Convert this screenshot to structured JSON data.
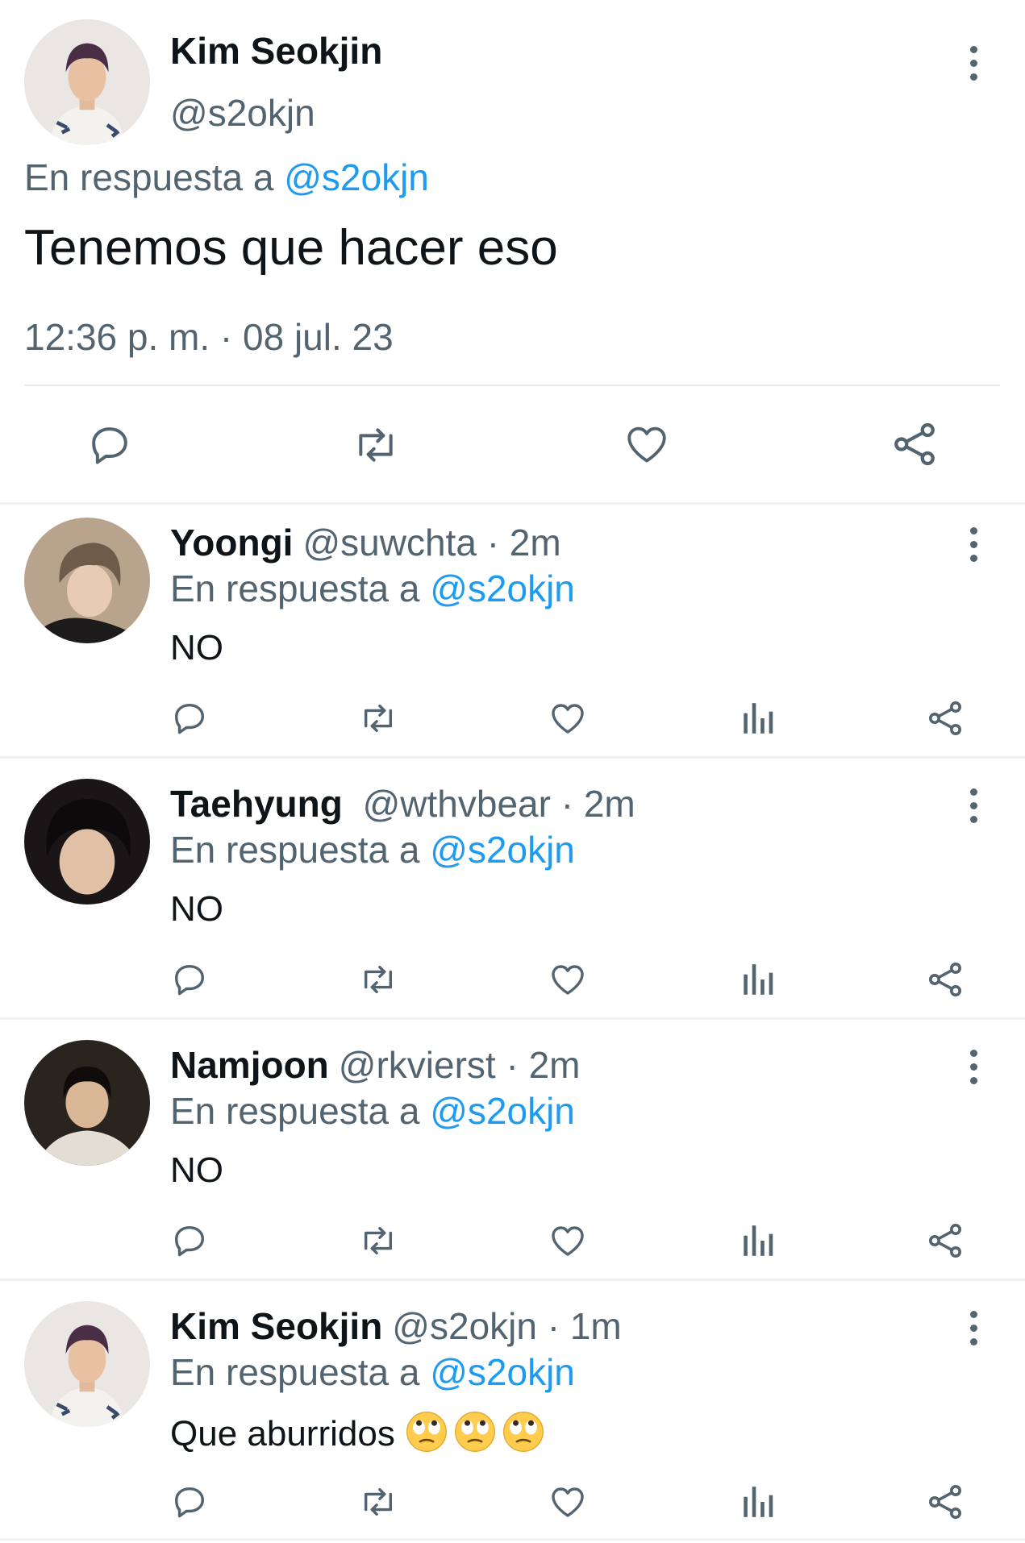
{
  "main_tweet": {
    "name": "Kim Seokjin",
    "handle": "@s2okjn",
    "reply_prefix": "En respuesta a",
    "reply_to": "@s2okjn",
    "text": "Tenemos que hacer eso",
    "timestamp": "12:36 p. m. · 08 jul. 23",
    "actions": [
      "reply-icon",
      "retweet-icon",
      "like-icon",
      "share-icon"
    ]
  },
  "replies": [
    {
      "name": "Yoongi",
      "handle": "@suwchta",
      "time": "· 2m",
      "reply_prefix": "En respuesta a",
      "reply_to": "@s2okjn",
      "text": "NO",
      "emoji_count": 0
    },
    {
      "name": "Taehyung",
      "handle": "@wthvbear",
      "time": "· 2m",
      "reply_prefix": "En respuesta a",
      "reply_to": "@s2okjn",
      "text": "NO",
      "emoji_count": 0
    },
    {
      "name": "Namjoon",
      "handle": "@rkvierst",
      "time": "· 2m",
      "reply_prefix": "En respuesta a",
      "reply_to": "@s2okjn",
      "text": "NO",
      "emoji_count": 0
    },
    {
      "name": "Kim Seokjin",
      "handle": "@s2okjn",
      "time": "· 1m",
      "reply_prefix": "En respuesta a",
      "reply_to": "@s2okjn",
      "text": "Que aburridos",
      "emoji": "rolling-eyes-face",
      "emoji_count": 3
    }
  ],
  "reply_actions": [
    "reply-icon",
    "retweet-icon",
    "like-icon",
    "views-icon",
    "share-icon"
  ],
  "colors": {
    "link": "#1d9bf0",
    "secondary": "#536471",
    "text": "#0f1419"
  }
}
